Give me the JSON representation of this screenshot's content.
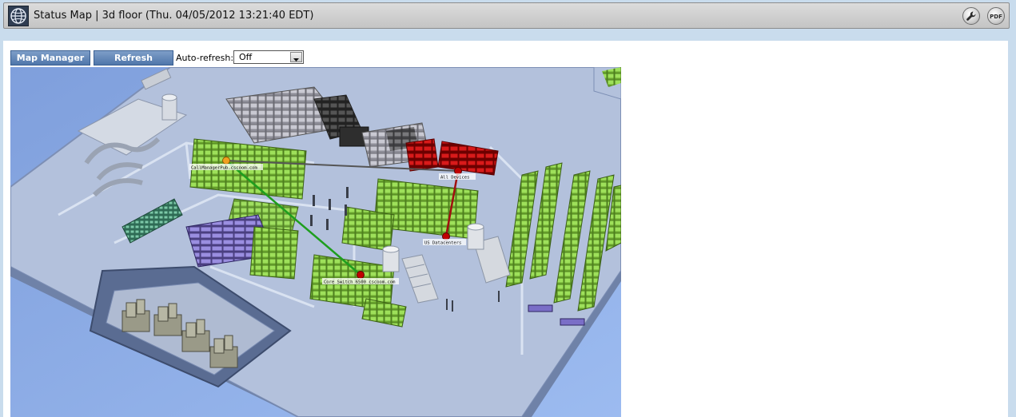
{
  "header": {
    "title": "Status Map | 3d floor (Thu. 04/05/2012 13:21:40 EDT)"
  },
  "toolbar": {
    "map_manager_label": "Map Manager",
    "refresh_label": "Refresh",
    "auto_refresh_label": "Auto-refresh:",
    "auto_refresh_value": "Off"
  },
  "map": {
    "labels": {
      "call_manager": "CallManagerPub.cscoom.com",
      "all_devices": "All Devices",
      "us_datacenter": "US Datacenters",
      "core_switch": "Core Switch 6500 cscoom.com"
    },
    "link_colors": {
      "normal": "#555555",
      "up": "#1e9e1e",
      "down": "#a01010"
    },
    "node_colors": {
      "warning": "#f0a020",
      "critical": "#c00000"
    }
  },
  "colors": {
    "button": "#5b7fb0",
    "title_bar": "#d0d0d0",
    "page_background": "#c9dced"
  }
}
